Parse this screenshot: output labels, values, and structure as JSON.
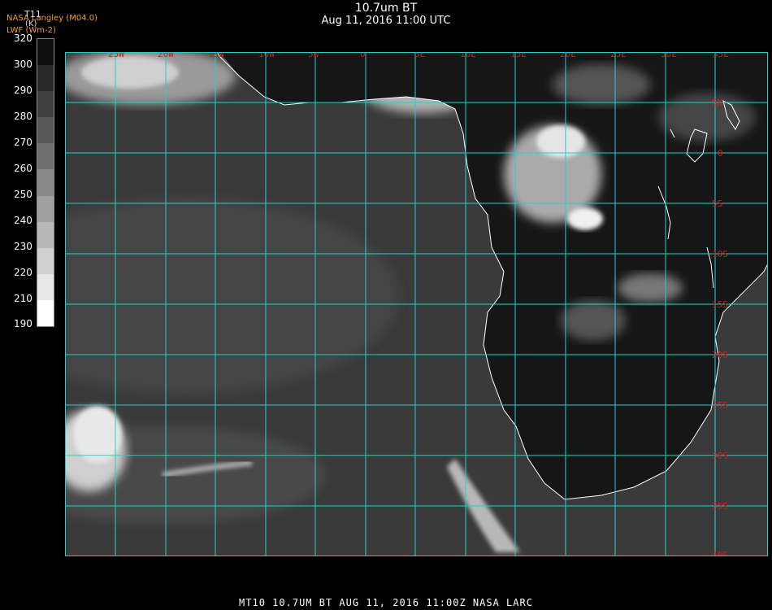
{
  "header": {
    "title": "10.7um BT",
    "datetime": "Aug 11, 2016 11:00 UTC",
    "source": "NASA Langley (M04.0)",
    "source2": "LWF (Wm-2)"
  },
  "legend": {
    "variable": "T11",
    "unit": "(K)",
    "ticks": [
      "320",
      "300",
      "290",
      "280",
      "270",
      "260",
      "250",
      "240",
      "230",
      "220",
      "210",
      "190"
    ]
  },
  "map": {
    "lon_labels": [
      "25W",
      "20W",
      "15W",
      "10W",
      "5W",
      "0",
      "5E",
      "10E",
      "15E",
      "20E",
      "25E",
      "30E",
      "35E"
    ],
    "lat_labels": [
      "5N",
      "0",
      "5S",
      "10S",
      "15S",
      "20S",
      "25S",
      "30S",
      "35S",
      "40S"
    ],
    "grid_color": "#20d0d0",
    "label_color": "#d02020",
    "coast_color": "#ffffff"
  },
  "footer": {
    "text": "MT10  10.7UM BT   AUG 11, 2016 11:00Z   NASA LARC"
  }
}
